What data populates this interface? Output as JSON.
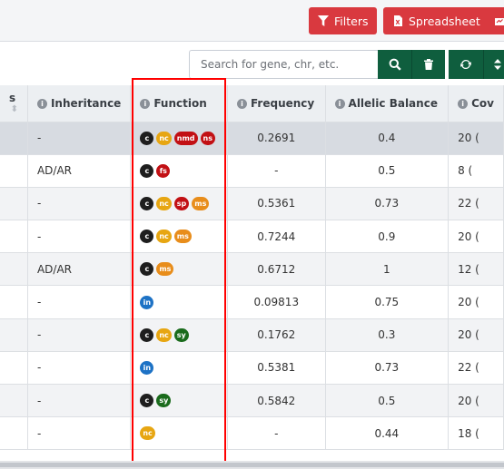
{
  "toolbar": {
    "filters_label": "Filters",
    "spreadsheet_label": "Spreadsheet"
  },
  "search": {
    "placeholder": "Search for gene, chr, etc."
  },
  "table": {
    "headers": {
      "partial": "s",
      "inheritance": "Inheritance",
      "function": "Function",
      "frequency": "Frequency",
      "allelic_balance": "Allelic Balance",
      "coverage": "Cov"
    },
    "rows": [
      {
        "inheritance": "-",
        "function": [
          "c",
          "nc",
          "nmd",
          "ns"
        ],
        "frequency": "0.2691",
        "allelic_balance": "0.4",
        "coverage": "20 ("
      },
      {
        "inheritance": "AD/AR",
        "function": [
          "c",
          "fs"
        ],
        "frequency": "-",
        "allelic_balance": "0.5",
        "coverage": "8 ("
      },
      {
        "inheritance": "-",
        "function": [
          "c",
          "nc",
          "sp",
          "ms"
        ],
        "frequency": "0.5361",
        "allelic_balance": "0.73",
        "coverage": "22 ("
      },
      {
        "inheritance": "-",
        "function": [
          "c",
          "nc",
          "ms"
        ],
        "frequency": "0.7244",
        "allelic_balance": "0.9",
        "coverage": "20 ("
      },
      {
        "inheritance": "AD/AR",
        "function": [
          "c",
          "ms"
        ],
        "frequency": "0.6712",
        "allelic_balance": "1",
        "coverage": "12 ("
      },
      {
        "inheritance": "-",
        "function": [
          "in"
        ],
        "frequency": "0.09813",
        "allelic_balance": "0.75",
        "coverage": "20 ("
      },
      {
        "inheritance": "-",
        "function": [
          "c",
          "nc",
          "sy"
        ],
        "frequency": "0.1762",
        "allelic_balance": "0.3",
        "coverage": "20 ("
      },
      {
        "inheritance": "-",
        "function": [
          "in"
        ],
        "frequency": "0.5381",
        "allelic_balance": "0.73",
        "coverage": "22 ("
      },
      {
        "inheritance": "-",
        "function": [
          "c",
          "sy"
        ],
        "frequency": "0.5842",
        "allelic_balance": "0.5",
        "coverage": "20 ("
      },
      {
        "inheritance": "-",
        "function": [
          "nc"
        ],
        "frequency": "-",
        "allelic_balance": "0.44",
        "coverage": "18 ("
      }
    ]
  },
  "badge_colors": {
    "c": "#1e1e1e",
    "nc": "#e7a612",
    "nmd": "#c21014",
    "ns": "#c21014",
    "fs": "#c21014",
    "sp": "#c21014",
    "ms": "#e88d1b",
    "in": "#1d72c5",
    "sy": "#1a6b1c"
  },
  "colors": {
    "filter_buttons": "#d9393f",
    "action_buttons": "#0f5e3e",
    "highlight_box": "#ff0000"
  }
}
